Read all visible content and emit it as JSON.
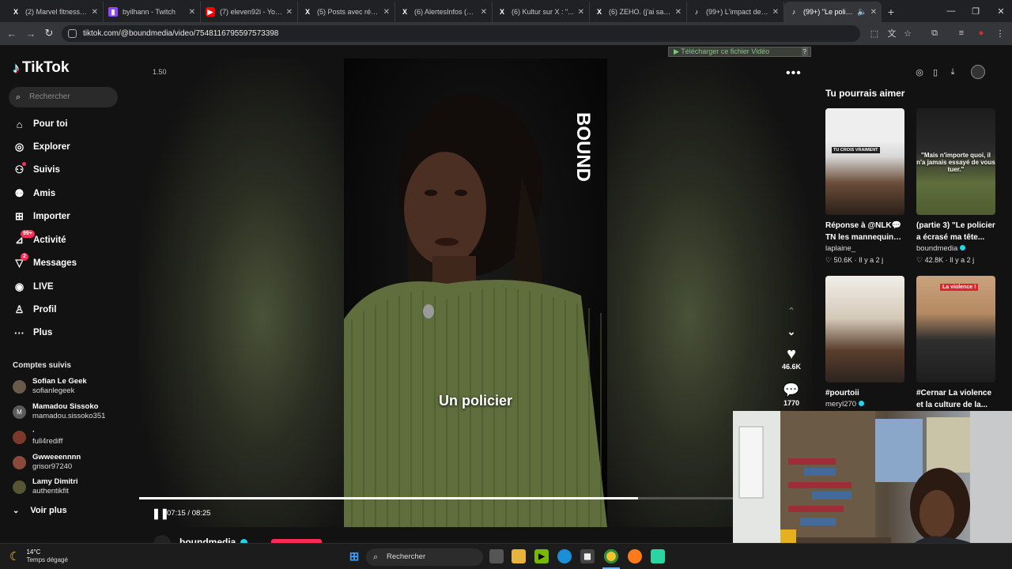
{
  "browser": {
    "tabs": [
      {
        "title": "(2) Marvel fitness #...",
        "icon": "x-icon",
        "active": false
      },
      {
        "title": "byilhann - Twitch",
        "icon": "twitch-icon",
        "active": false
      },
      {
        "title": "(7) eleven92i - YouTube",
        "icon": "youtube-icon",
        "active": false
      },
      {
        "title": "(5) Posts avec réponse",
        "icon": "x-icon",
        "active": false
      },
      {
        "title": "(6) AlertesInfos (@Al...",
        "icon": "x-icon",
        "active": false
      },
      {
        "title": "(6) Kultur sur X : \"...",
        "icon": "x-icon",
        "active": false
      },
      {
        "title": "(6) ZEHO. (j'ai sauté)",
        "icon": "x-icon",
        "active": false
      },
      {
        "title": "(99+) L'impact des vi...",
        "icon": "tiktok-icon",
        "active": false
      },
      {
        "title": "(99+) \"Le policier",
        "icon": "tiktok-icon",
        "active": true
      }
    ],
    "url": "tiktok.com/@boundmedia/video/7548116795597573398"
  },
  "tiktok": {
    "logo_text": "TikTok",
    "search_placeholder": "Rechercher",
    "nav": [
      {
        "label": "Pour toi",
        "icon": "home-icon"
      },
      {
        "label": "Explorer",
        "icon": "compass-icon"
      },
      {
        "label": "Suivis",
        "icon": "following-icon"
      },
      {
        "label": "Amis",
        "icon": "friends-icon"
      },
      {
        "label": "Importer",
        "icon": "upload-icon"
      },
      {
        "label": "Activité",
        "icon": "activity-icon",
        "badge": "99+"
      },
      {
        "label": "Messages",
        "icon": "messages-icon",
        "badge": "2"
      },
      {
        "label": "LIVE",
        "icon": "live-icon"
      },
      {
        "label": "Profil",
        "icon": "profile-icon"
      },
      {
        "label": "Plus",
        "icon": "more-icon"
      }
    ],
    "followed_title": "Comptes suivis",
    "followed": [
      {
        "name": "Sofian Le Geek",
        "handle": "sofianlegeek",
        "avatar": ""
      },
      {
        "name": "Mamadou Sissoko",
        "handle": "mamadou.sissoko351",
        "avatar": "M"
      },
      {
        "name": "·",
        "handle": "full4rediff",
        "avatar": ""
      },
      {
        "name": "Gwweeennnn",
        "handle": "grisor97240",
        "avatar": ""
      },
      {
        "name": "Lamy Dimitri",
        "handle": "authentikfit",
        "avatar": ""
      }
    ],
    "see_more": "Voir plus",
    "video": {
      "speed": "1.50",
      "subtitle": "Un policier",
      "watermark": "BOUND",
      "time": "07:15 / 08:25",
      "progress": 0.86,
      "likes": "46.6K",
      "comments": "1770",
      "author": "boundmedia"
    },
    "download_bar": "Télécharger ce fichier Vidéo",
    "download_help": "?",
    "suggest_title": "Tu pourrais aimer",
    "suggestions": [
      {
        "caption": "Réponse à @NLK💬",
        "caption2": "TN les mannequins i...",
        "author": "laplaine_",
        "stats": "♡ 50.6K · Il y a 2 j",
        "overlay": "TU CROIS VRAIMENT"
      },
      {
        "caption": "(partie 3) \"Le policier",
        "caption2": "a écrasé ma tête...",
        "author": "boundmedia",
        "stats": "♡ 42.8K · Il y a 2 j",
        "overlay": "\"Mais n'importe quoi, il n'a jamais essayé de vous tuer.\""
      },
      {
        "caption": "#pourtoii",
        "caption2": "",
        "author": "meryl270",
        "stats": "",
        "overlay": ""
      },
      {
        "caption": "#Cernar La violence",
        "caption2": "et la culture de la...",
        "author": "",
        "stats": "",
        "overlay": "La violence !"
      }
    ]
  },
  "taskbar": {
    "temp": "14°C",
    "weather": "Temps dégagé",
    "search": "Rechercher"
  }
}
